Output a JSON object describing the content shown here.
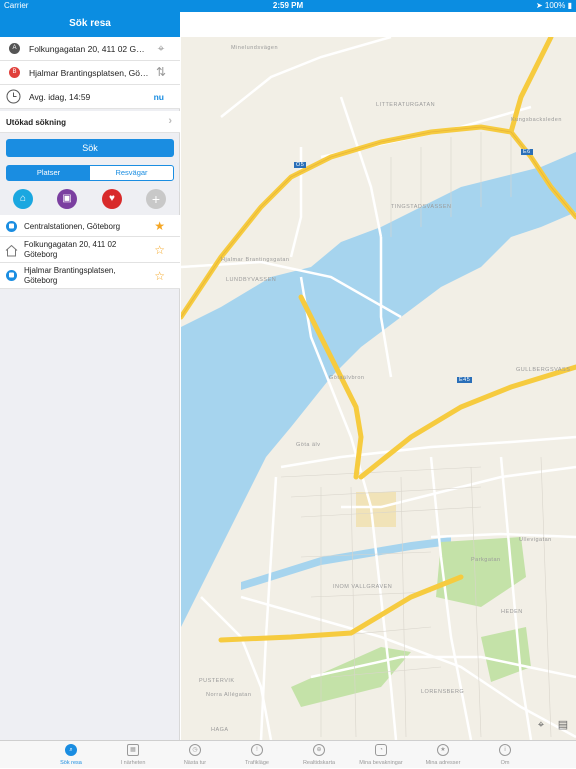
{
  "status": {
    "carrier": "Carrier",
    "time": "2:59 PM",
    "battery": "100%"
  },
  "header": {
    "title": "Sök resa"
  },
  "form": {
    "from": "Folkungagatan 20, 411 02 Göteborg",
    "to": "Hjalmar Brantingsplatsen, Göteborg",
    "time": "Avg. idag, 14:59",
    "now_label": "nu",
    "extended": "Utökad sökning",
    "search_label": "Sök"
  },
  "segments": {
    "places": "Platser",
    "routes": "Resvägar"
  },
  "quick_icons": [
    {
      "name": "home-icon",
      "color": "#1aa7e0"
    },
    {
      "name": "briefcase-icon",
      "color": "#7b3fa0"
    },
    {
      "name": "heart-icon",
      "color": "#d82a2a"
    },
    {
      "name": "add-icon",
      "color": "#c8c8c8"
    }
  ],
  "places": [
    {
      "label": "Centralstationen, Göteborg",
      "icon": "tram-icon",
      "favorite": true
    },
    {
      "label": "Folkungagatan 20, 411 02 Göteborg",
      "icon": "house-icon",
      "favorite": false
    },
    {
      "label": "Hjalmar Brantingsplatsen, Göteborg",
      "icon": "tram-icon",
      "favorite": false
    }
  ],
  "map": {
    "labels": [
      "Minelundsvägen",
      "LITTERATURGATAN",
      "Kungsbacksleden",
      "E6",
      "Ö5",
      "TINGSTADSVASSEN",
      "Hjalmar Brantingsgatan",
      "LUNDBYVASSEN",
      "GULLBERGSVASS",
      "E45",
      "Götaälvbron",
      "Göta älv",
      "Ullevigatan",
      "INOM VALLGRAVEN",
      "HEDEN",
      "LORENSBERG",
      "PUSTERVIK",
      "HAGA",
      "Norra Allégatan",
      "Parkgatan"
    ],
    "colors": {
      "water": "#a6d4ee",
      "park": "#c4e2a8",
      "highway": "#f6cb3f",
      "road": "#ffffff"
    }
  },
  "tabs": [
    {
      "label": "Sök resa",
      "icon": "search-trip-icon",
      "active": true
    },
    {
      "label": "I närheten",
      "icon": "grid-icon",
      "active": false
    },
    {
      "label": "Nästa tur",
      "icon": "clock-icon",
      "active": false
    },
    {
      "label": "Trafikläge",
      "icon": "alert-icon",
      "active": false
    },
    {
      "label": "Realtidskarta",
      "icon": "globe-icon",
      "active": false
    },
    {
      "label": "Mina bevakningar",
      "icon": "watch-icon",
      "active": false
    },
    {
      "label": "Mina adresser",
      "icon": "star-icon",
      "active": false
    },
    {
      "label": "Om",
      "icon": "info-icon",
      "active": false
    }
  ]
}
